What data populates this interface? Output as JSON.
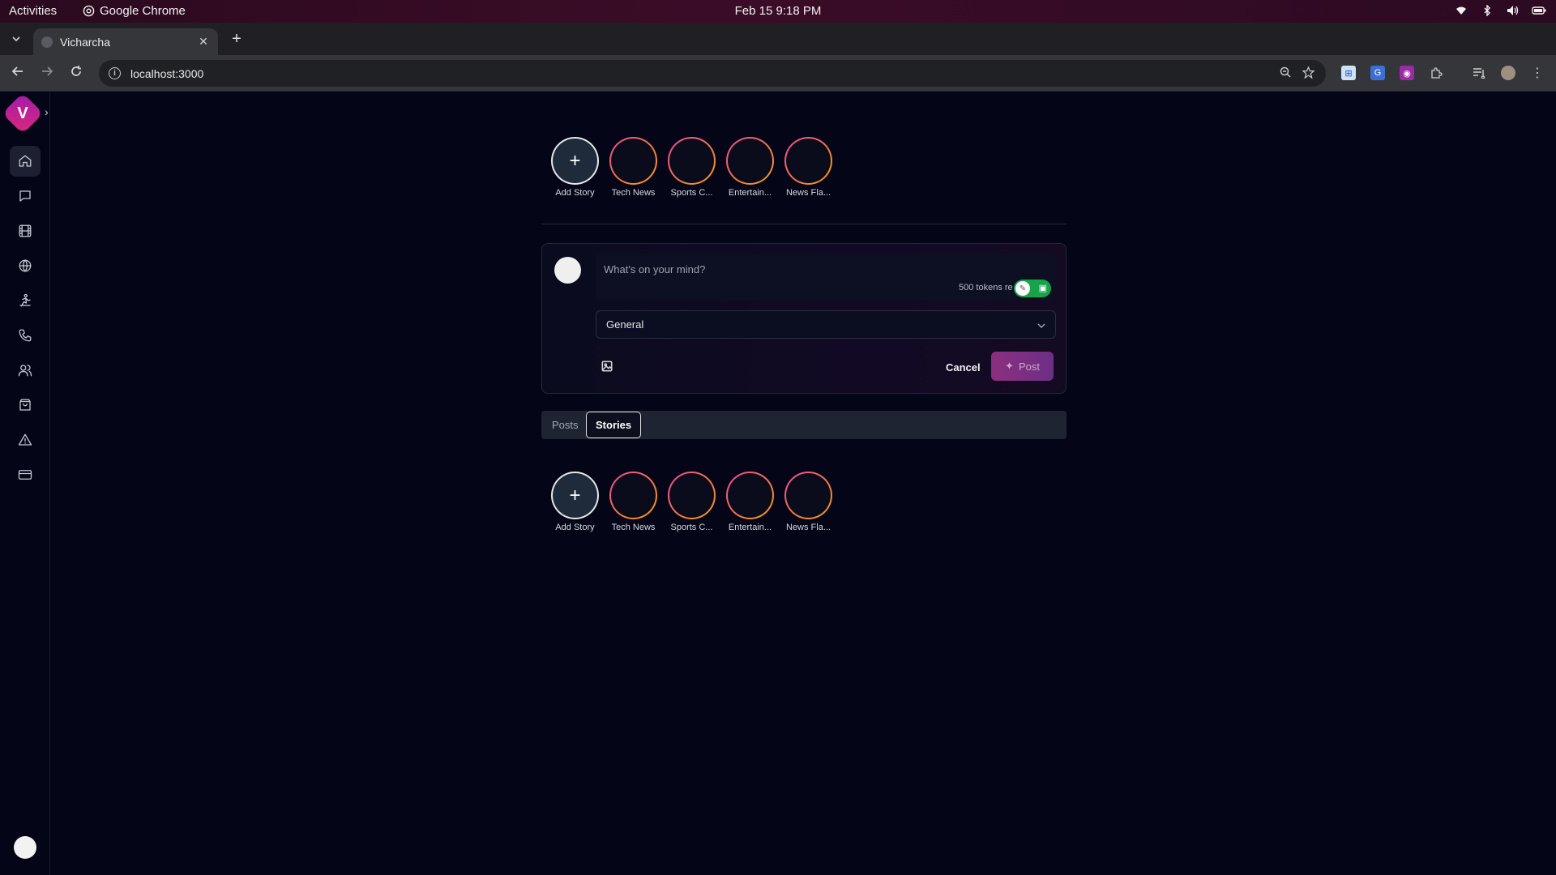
{
  "system_bar": {
    "activities": "Activities",
    "app_name": "Google Chrome",
    "datetime": "Feb 15  9:18 PM",
    "tray_icons": [
      "wifi-icon",
      "bluetooth-icon",
      "volume-icon",
      "battery-icon"
    ]
  },
  "browser": {
    "tab_title": "Vicharcha",
    "url": "localhost:3000",
    "extensions": [
      "extension-1-icon",
      "translate-icon",
      "extension-3-icon",
      "puzzle-icon"
    ]
  },
  "sidebar": {
    "logo_letter": "V",
    "items": [
      "home",
      "messages",
      "reels",
      "explore",
      "fitness",
      "calls",
      "contacts",
      "shop",
      "alerts",
      "payments"
    ]
  },
  "stories_top": [
    {
      "label": "Add Story",
      "is_add": true
    },
    {
      "label": "Tech News"
    },
    {
      "label": "Sports C..."
    },
    {
      "label": "Entertain..."
    },
    {
      "label": "News Fla..."
    }
  ],
  "composer": {
    "placeholder": "What's on your mind?",
    "tokens": "500 tokens re",
    "category": "General",
    "cancel_label": "Cancel",
    "post_label": "Post"
  },
  "feed_tabs": {
    "posts": "Posts",
    "stories": "Stories",
    "active": "Stories"
  },
  "stories_bottom": [
    {
      "label": "Add Story",
      "is_add": true
    },
    {
      "label": "Tech News"
    },
    {
      "label": "Sports C..."
    },
    {
      "label": "Entertain..."
    },
    {
      "label": "News Fla..."
    }
  ],
  "colors": {
    "background": "#040617",
    "story_ring_start": "#ec4899",
    "story_ring_end": "#f59e0b",
    "toggle_on": "#16a34a",
    "post_button": "#8b2f7f"
  }
}
